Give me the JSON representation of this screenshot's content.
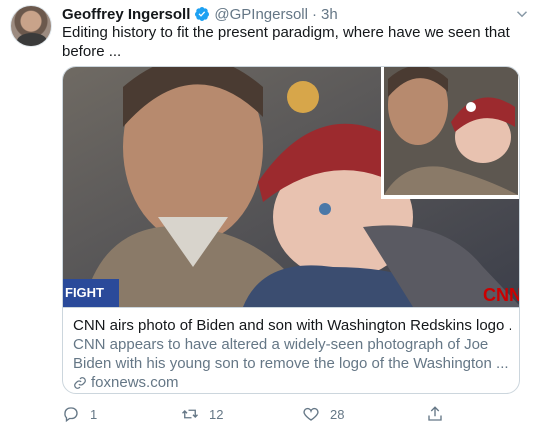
{
  "tweet": {
    "author_name": "Geoffrey Ingersoll",
    "handle": "@GPIngersoll",
    "time": "3h",
    "dot": "·",
    "text": "Editing history to fit the present paradigm, where have we seen that before ..."
  },
  "card": {
    "image_overlay_left": "FIGHT",
    "image_overlay_brand": "CNN",
    "title": "CNN airs photo of Biden and son with Washington Redskins logo ...",
    "description": "CNN appears to have altered a widely-seen photograph of Joe Biden with his young son to remove the logo of the Washington ...",
    "domain": "foxnews.com"
  },
  "actions": {
    "replies": "1",
    "retweets": "12",
    "likes": "28"
  },
  "icons": {
    "verified": "verified-badge-icon",
    "caret": "chevron-down-icon",
    "reply": "reply-icon",
    "retweet": "retweet-icon",
    "like": "heart-icon",
    "share": "share-icon",
    "link": "link-icon"
  },
  "colors": {
    "accent": "#1da1f2",
    "text_primary": "#14171a",
    "text_secondary": "#657786",
    "border": "#ccd6dd"
  }
}
